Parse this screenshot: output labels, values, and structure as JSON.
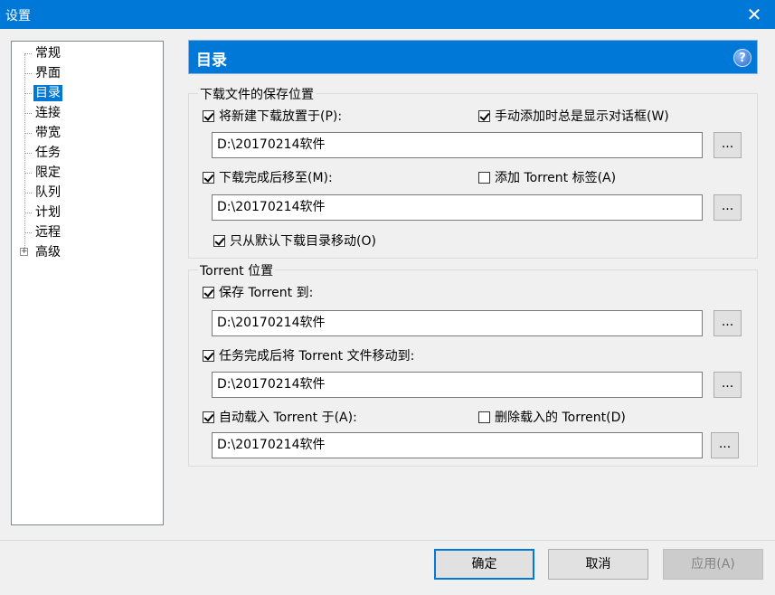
{
  "window": {
    "title": "设置"
  },
  "tree": {
    "items": [
      {
        "label": "常规"
      },
      {
        "label": "界面"
      },
      {
        "label": "目录",
        "selected": true
      },
      {
        "label": "连接"
      },
      {
        "label": "带宽"
      },
      {
        "label": "任务"
      },
      {
        "label": "限定"
      },
      {
        "label": "队列"
      },
      {
        "label": "计划"
      },
      {
        "label": "远程"
      },
      {
        "label": "高级",
        "expandable": true,
        "expander": "⊞"
      }
    ]
  },
  "header": {
    "title": "目录",
    "help_symbol": "?"
  },
  "download_group": {
    "title": "下载文件的保存位置",
    "new_dl_checkbox": {
      "label": "将新建下载放置于(P):",
      "checked": true
    },
    "show_dialog_checkbox": {
      "label": "手动添加时总是显示对话框(W)",
      "checked": true
    },
    "new_dl_path": "D:\\20170214软件",
    "move_completed_checkbox": {
      "label": "下载完成后移至(M):",
      "checked": true
    },
    "add_tag_checkbox": {
      "label": "添加 Torrent 标签(A)",
      "checked": false
    },
    "move_completed_path": "D:\\20170214软件",
    "only_default_checkbox": {
      "label": "只从默认下载目录移动(O)",
      "checked": true
    }
  },
  "torrent_group": {
    "title": "Torrent 位置",
    "save_torrent_checkbox": {
      "label": "保存 Torrent 到:",
      "checked": true
    },
    "save_torrent_path": "D:\\20170214软件",
    "move_torrent_checkbox": {
      "label": "任务完成后将 Torrent 文件移动到:",
      "checked": true
    },
    "move_torrent_path": "D:\\20170214软件",
    "autoload_checkbox": {
      "label": "自动载入 Torrent 于(A):",
      "checked": true
    },
    "delete_loaded_checkbox": {
      "label": "删除载入的 Torrent(D)",
      "checked": false
    },
    "autoload_path": "D:\\20170214软件"
  },
  "browse_label": "...",
  "buttons": {
    "ok": "确定",
    "cancel": "取消",
    "apply": "应用(A)"
  },
  "colors": {
    "accent": "#0078d7",
    "titlebar": "#0078d7",
    "background": "#f0f0f0"
  },
  "icons": {
    "close": "close-icon",
    "help": "help-icon",
    "expander": "expand-plus-icon"
  }
}
